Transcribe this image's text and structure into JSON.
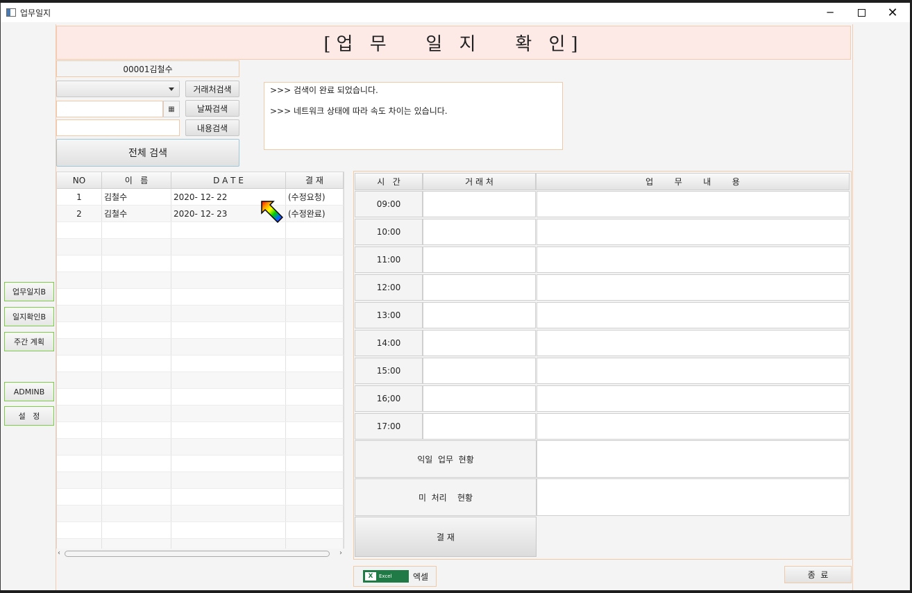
{
  "window": {
    "title": "업무일지"
  },
  "header": {
    "title": "[업 무   일 지   확 인]"
  },
  "filters": {
    "user": "00001김철수",
    "vendor_search_label": "거래처검색",
    "date_search_label": "날짜검색",
    "content_search_label": "내용검색",
    "all_search_label": "전체 검색",
    "date_value": "",
    "content_value": ""
  },
  "log": {
    "lines": [
      ">>> 검색이 완료 되었습니다.",
      ">>> 네트워크 상태에 따라 속도 차이는 있습니다."
    ]
  },
  "list": {
    "headers": [
      "NO",
      "이   름",
      "D A T E",
      "결 재"
    ],
    "rows": [
      {
        "no": "1",
        "name": "김철수",
        "date": "2020- 12- 22",
        "status": "(수정요청)"
      },
      {
        "no": "2",
        "name": "김철수",
        "date": "2020- 12- 23",
        "status": "(수정완료)"
      }
    ]
  },
  "side_menu": {
    "items": [
      "업무일지B",
      "일지확인B",
      "주간 계획",
      "ADMINB",
      "설   정"
    ]
  },
  "schedule": {
    "headers": [
      "시   간",
      "거 래 처",
      "업        무        내        용"
    ],
    "times": [
      "09:00",
      "10:00",
      "11:00",
      "12:00",
      "13:00",
      "14:00",
      "15:00",
      "16;00",
      "17:00"
    ],
    "next_day_label": "익일  업무  현황",
    "pending_label": "미  처리    현황",
    "approve_label": "결 재"
  },
  "footer": {
    "excel_logo_text": "Excel",
    "excel_label": "엑셀",
    "exit_label": "종  료"
  },
  "colors": {
    "accent_border": "#f0c9a8",
    "header_bg": "#fde9e6",
    "side_border": "#7ccc48"
  }
}
